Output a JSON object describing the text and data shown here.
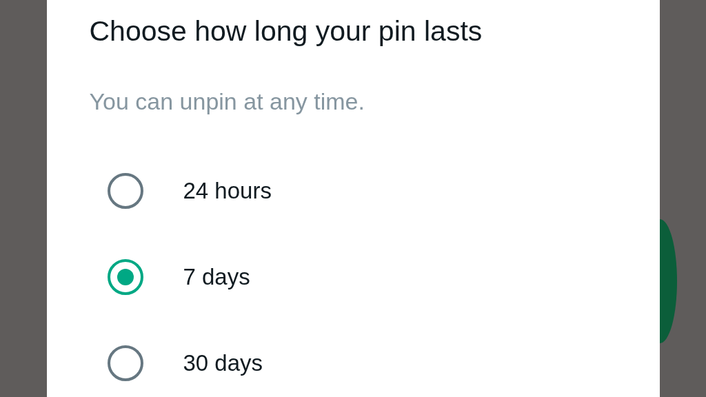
{
  "dialog": {
    "title": "Choose how long your pin lasts",
    "subtitle": "You can unpin at any time.",
    "options": [
      {
        "label": "24 hours",
        "selected": false
      },
      {
        "label": "7 days",
        "selected": true
      },
      {
        "label": "30 days",
        "selected": false
      }
    ]
  }
}
